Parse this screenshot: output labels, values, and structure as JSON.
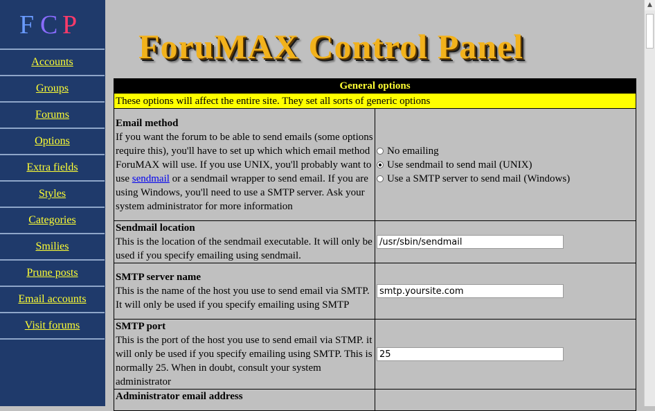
{
  "logo": {
    "letters": [
      "F",
      "C",
      "P"
    ],
    "colors": [
      "#6a9bff",
      "#8a6cff",
      "#ff3a6a"
    ]
  },
  "sidebar": {
    "items": [
      {
        "label": "Accounts"
      },
      {
        "label": "Groups"
      },
      {
        "label": "Forums"
      },
      {
        "label": "Options"
      },
      {
        "label": "Extra fields"
      },
      {
        "label": "Styles"
      },
      {
        "label": "Categories"
      },
      {
        "label": "Smilies"
      },
      {
        "label": "Prune posts"
      },
      {
        "label": "Email accounts"
      },
      {
        "label": "Visit forums"
      }
    ]
  },
  "header": {
    "title": "ForuMAX Control Panel"
  },
  "section": {
    "title": "General options",
    "intro": "These options will affect the entire site. They set all sorts of generic options"
  },
  "options": {
    "email_method": {
      "name": "Email method",
      "desc_before": "If you want the forum to be able to send emails (some options require this), you'll have to set up which which email method ForuMAX will use. If you use UNIX, you'll probably want to use ",
      "link": "sendmail",
      "desc_after": " or a sendmail wrapper to send email. If you are using Windows, you'll need to use a SMTP server. Ask your system administrator for more information",
      "choices": [
        {
          "label": "No emailing",
          "selected": false
        },
        {
          "label": "Use sendmail to send mail (UNIX)",
          "selected": true
        },
        {
          "label": "Use a SMTP server to send mail (Windows)",
          "selected": false
        }
      ]
    },
    "sendmail_location": {
      "name": "Sendmail location",
      "desc": "This is the location of the sendmail executable. It will only be used if you specify emailing using sendmail.",
      "value": "/usr/sbin/sendmail"
    },
    "smtp_server": {
      "name": "SMTP server name",
      "desc": "This is the name of the host you use to send email via SMTP. It will only be used if you specify emailing using SMTP",
      "value": "smtp.yoursite.com"
    },
    "smtp_port": {
      "name": "SMTP port",
      "desc": "This is the port of the host you use to send email via STMP. it will only be used if you specify emailing using SMTP. This is normally 25. When in doubt, consult your system administrator",
      "value": "25"
    },
    "admin_email": {
      "name": "Administrator email address"
    }
  }
}
